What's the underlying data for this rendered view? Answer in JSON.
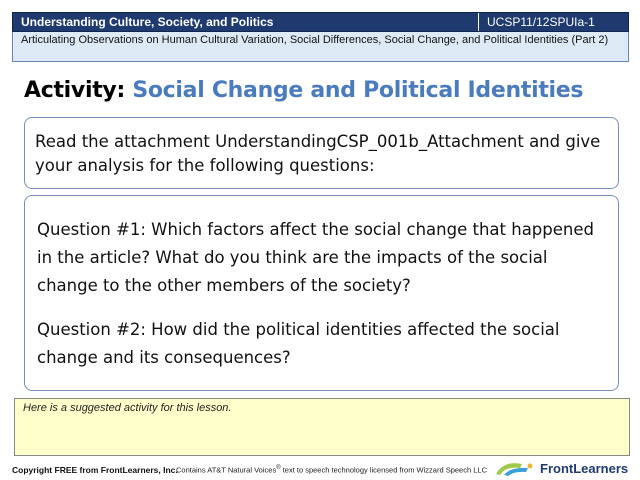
{
  "header": {
    "title": "Understanding Culture, Society, and Politics",
    "code": "UCSP11/12SPUIa-1",
    "subtitle": "Articulating Observations on Human Cultural Variation, Social Differences, Social Change, and Political Identities (Part 2)"
  },
  "activity": {
    "label": "Activity:",
    "name": "Social Change and Political Identities"
  },
  "intro": {
    "text": "Read the attachment UnderstandingCSP_001b_Attachment  and give your analysis for the following questions:"
  },
  "questions": [
    {
      "text": "Question #1: Which factors affect the social change that happened in the article? What do you think are the impacts of the social change to the other members of the society?"
    },
    {
      "text": "Question #2: How did the political identities affected the social change and its consequences?"
    }
  ],
  "note": {
    "text": "Here is a suggested activity for this lesson."
  },
  "footer": {
    "copyright": "Copyright FREE from FrontLearners, Inc.",
    "voices_before": "Contains AT&T Natural Voices",
    "voices_mark": "®",
    "voices_after": " text to speech technology licensed from Wizzard Speech LLC",
    "logo_text": "FrontLearners"
  },
  "colors": {
    "header_bg": "#1f3a6e",
    "subheader_bg": "#ddeaf6",
    "activity_accent": "#4a7cbd",
    "note_bg": "#ffffcc"
  }
}
